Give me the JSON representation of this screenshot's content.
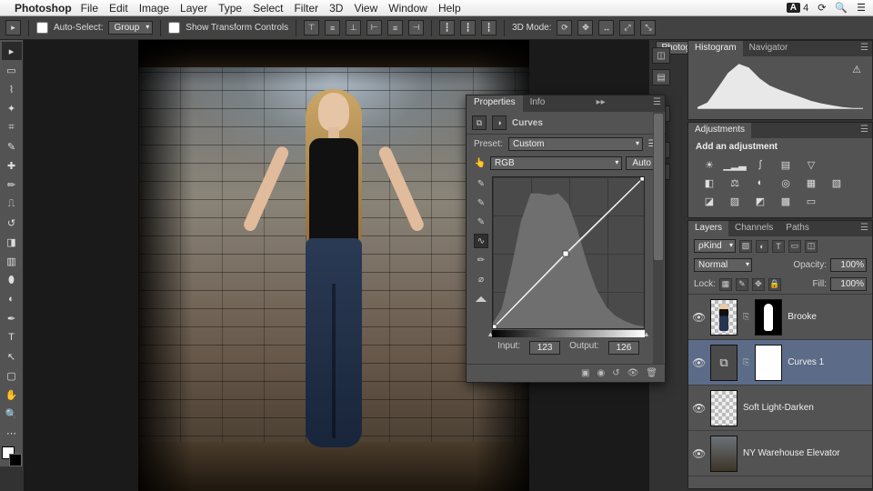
{
  "menubar": {
    "app": "Photoshop",
    "items": [
      "File",
      "Edit",
      "Image",
      "Layer",
      "Type",
      "Select",
      "Filter",
      "3D",
      "View",
      "Window",
      "Help"
    ],
    "sys_badge_brand": "A",
    "sys_badge_count": "4"
  },
  "options": {
    "auto_select_label": "Auto-Select:",
    "auto_select_value": "Group",
    "show_transform_label": "Show Transform Controls",
    "mode_label": "3D Mode:",
    "workspace": "Photography"
  },
  "tools": [
    "move",
    "marquee",
    "lasso",
    "wand",
    "crop",
    "eyedrop",
    "heal",
    "brush",
    "stamp",
    "history",
    "eraser",
    "gradient",
    "blur",
    "dodge",
    "pen",
    "type",
    "path",
    "rect",
    "hand",
    "zoom"
  ],
  "properties": {
    "tabs": [
      "Properties",
      "Info"
    ],
    "title": "Curves",
    "preset_label": "Preset:",
    "preset_value": "Custom",
    "channel_value": "RGB",
    "auto_label": "Auto",
    "input_label": "Input:",
    "input_value": "123",
    "output_label": "Output:",
    "output_value": "126"
  },
  "histogram": {
    "tabs": [
      "Histogram",
      "Navigator"
    ]
  },
  "adjustments": {
    "tab": "Adjustments",
    "heading": "Add an adjustment"
  },
  "layers_panel": {
    "tabs": [
      "Layers",
      "Channels",
      "Paths"
    ],
    "filter_label": "ρKind",
    "blend_mode": "Normal",
    "opacity_label": "Opacity:",
    "opacity_value": "100%",
    "lock_label": "Lock:",
    "fill_label": "Fill:",
    "fill_value": "100%",
    "layers": [
      {
        "name": "Brooke"
      },
      {
        "name": "Curves 1"
      },
      {
        "name": "Soft Light-Darken"
      },
      {
        "name": "NY Warehouse Elevator"
      }
    ]
  },
  "chart_data": [
    {
      "type": "area",
      "title": "Histogram",
      "x": [
        0,
        16,
        32,
        48,
        64,
        80,
        96,
        112,
        128,
        144,
        160,
        176,
        192,
        208,
        224,
        240,
        255
      ],
      "values": [
        4,
        14,
        46,
        78,
        96,
        88,
        66,
        50,
        40,
        32,
        24,
        18,
        12,
        8,
        5,
        3,
        2
      ],
      "ylim": [
        0,
        100
      ],
      "xlabel": "",
      "ylabel": ""
    },
    {
      "type": "line",
      "title": "Curves",
      "xlabel": "Input",
      "ylabel": "Output",
      "xlim": [
        0,
        255
      ],
      "ylim": [
        0,
        255
      ],
      "series": [
        {
          "name": "curve",
          "x": [
            0,
            123,
            255
          ],
          "y": [
            0,
            126,
            255
          ]
        },
        {
          "name": "baseline",
          "x": [
            0,
            255
          ],
          "y": [
            0,
            255
          ]
        }
      ],
      "histogram_backdrop": {
        "x": [
          0,
          16,
          32,
          48,
          64,
          80,
          96,
          112,
          128,
          144,
          160,
          176,
          192,
          208,
          224,
          240,
          255
        ],
        "values": [
          6,
          22,
          70,
          118,
          150,
          150,
          148,
          150,
          138,
          110,
          72,
          44,
          24,
          14,
          8,
          4,
          2
        ]
      },
      "selected_point": {
        "input": 123,
        "output": 126
      }
    }
  ]
}
